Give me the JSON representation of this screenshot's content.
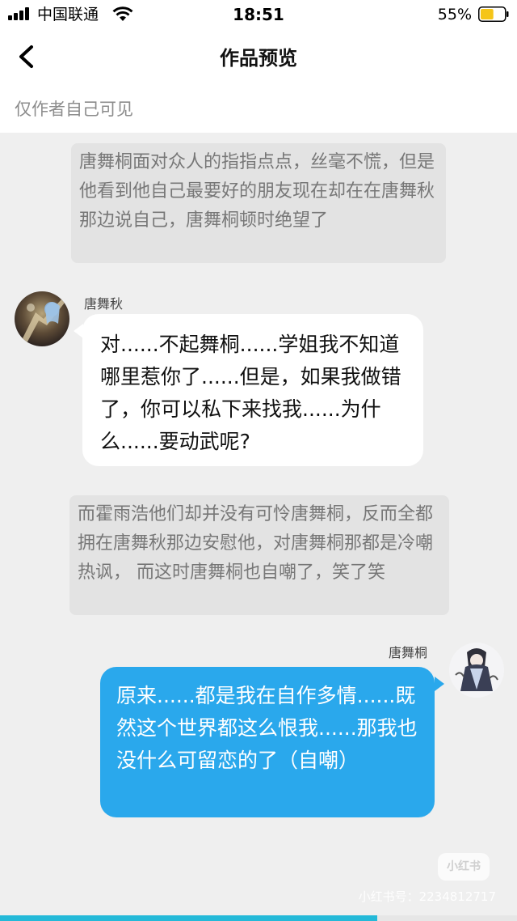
{
  "status_bar": {
    "carrier": "中国联通",
    "time": "18:51",
    "battery_percent": "55%",
    "battery_level": 0.55,
    "battery_color": "#f5c518",
    "signal_icon": "cellular-signal-icon",
    "wifi_icon": "wifi-icon"
  },
  "nav": {
    "back_icon": "chevron-left-icon",
    "title": "作品预览"
  },
  "visibility_note": "仅作者自己可见",
  "messages": [
    {
      "kind": "narration",
      "text": "唐舞桐面对众人的指指点点，丝毫不慌，但是他看到他自己最要好的朋友现在却在在唐舞秋那边说自己，唐舞桐顿时绝望了"
    },
    {
      "kind": "speech",
      "side": "left",
      "speaker": "唐舞秋",
      "avatar_icon": "avatar-image-tang-wuqiu",
      "text": "对......不起舞桐......学姐我不知道哪里惹你了......但是，如果我做错了，你可以私下来找我......为什么......要动武呢?"
    },
    {
      "kind": "narration",
      "text": "而霍雨浩他们却并没有可怜唐舞桐，反而全都拥在唐舞秋那边安慰他，对唐舞桐那都是冷嘲热讽， 而这时唐舞桐也自嘲了，笑了笑"
    },
    {
      "kind": "speech",
      "side": "right",
      "speaker": "唐舞桐",
      "avatar_icon": "avatar-image-tang-wutong",
      "text": "原来......都是我在自作多情......既然这个世界都这么恨我......那我也没什么可留恋的了（自嘲）"
    }
  ],
  "watermark": {
    "logo": "小红书",
    "id_text": "小红书号：2234812717"
  },
  "progress": {
    "fraction": 0.73,
    "color": "#24b9d8"
  },
  "colors": {
    "right_bubble": "#2aa8ec",
    "left_bubble": "#ffffff",
    "narration_bubble": "#e3e3e3",
    "background": "#efefef"
  }
}
